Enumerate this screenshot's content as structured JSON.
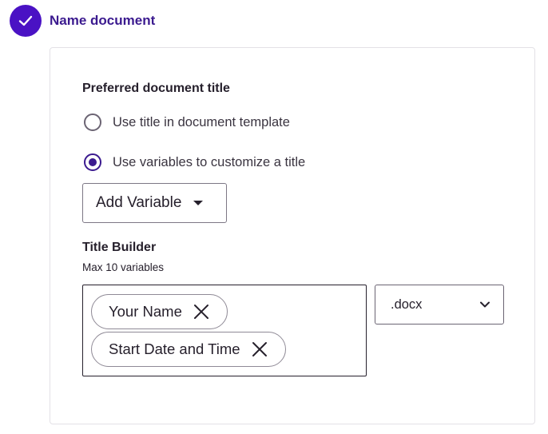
{
  "step": {
    "title": "Name document",
    "status": "completed",
    "icon": "check-icon",
    "accent_color": "#4a12c4"
  },
  "preferred_title": {
    "label": "Preferred document title",
    "options": [
      {
        "label": "Use title in document template",
        "selected": false
      },
      {
        "label": "Use variables to customize a title",
        "selected": true
      }
    ]
  },
  "add_variable": {
    "label": "Add Variable",
    "icon": "caret-down-icon"
  },
  "title_builder": {
    "title": "Title Builder",
    "subtitle": "Max 10 variables",
    "chips": [
      {
        "label": "Your Name",
        "remove_icon": "close-icon"
      },
      {
        "label": "Start Date and Time",
        "remove_icon": "close-icon"
      }
    ]
  },
  "extension_select": {
    "value": ".docx",
    "icon": "chevron-down-icon"
  }
}
